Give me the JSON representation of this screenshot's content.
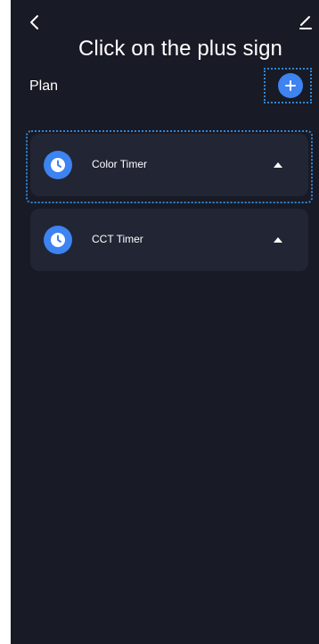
{
  "instruction": "Click on the plus sign",
  "plan": {
    "label": "Plan"
  },
  "timers": [
    {
      "name": "Color Timer",
      "icon": "clock-icon",
      "toggle_icon": "caret-up-icon"
    },
    {
      "name": "CCT Timer",
      "icon": "clock-icon",
      "toggle_icon": "caret-up-icon"
    }
  ],
  "header": {
    "back_icon": "chevron-left-icon",
    "edit_icon": "edit-icon",
    "add_icon": "plus-icon"
  },
  "colors": {
    "background": "#181a25",
    "card": "#222534",
    "accent": "#3d83f1",
    "highlight": "#2f86d6"
  }
}
